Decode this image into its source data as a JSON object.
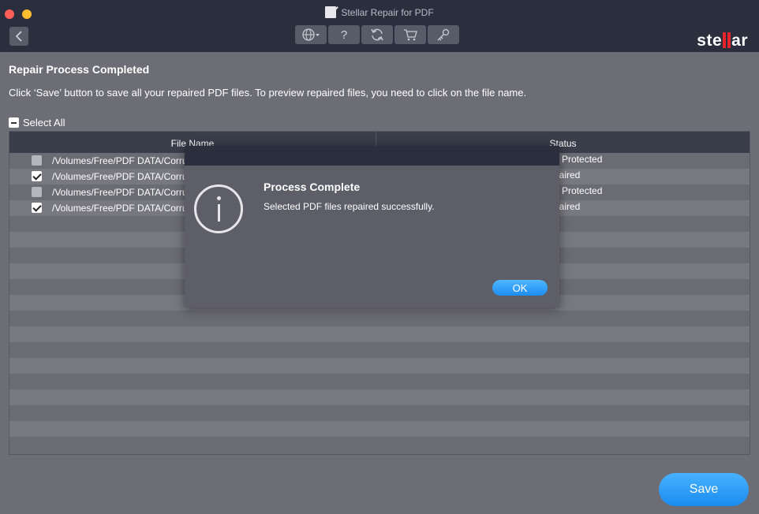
{
  "window": {
    "title": "Stellar Repair for PDF"
  },
  "toolbar": {
    "tools": [
      {
        "name": "language",
        "icon": "globe-icon"
      },
      {
        "name": "help",
        "icon": "question-icon",
        "glyph": "?"
      },
      {
        "name": "update",
        "icon": "refresh-icon"
      },
      {
        "name": "buy",
        "icon": "cart-icon"
      },
      {
        "name": "activate",
        "icon": "key-icon"
      }
    ]
  },
  "brand": {
    "logo_prefix": "ste",
    "logo_suffix": "ar",
    "accent": "#e8242a"
  },
  "main": {
    "heading": "Repair Process Completed",
    "instruction": "Click ‘Save’ button to save all your repaired PDF files. To preview repaired files, you need to click on the file name.",
    "select_all_label": "Select All"
  },
  "table": {
    "columns": [
      "File Name",
      "Status"
    ],
    "rows": [
      {
        "checked": false,
        "path": "/Volumes/Free/PDF DATA/Corru",
        "status": "d Protected"
      },
      {
        "checked": true,
        "path": "/Volumes/Free/PDF DATA/Corru",
        "status": "paired"
      },
      {
        "checked": false,
        "path": "/Volumes/Free/PDF DATA/Corru",
        "status": "d Protected"
      },
      {
        "checked": true,
        "path": "/Volumes/Free/PDF DATA/Corru",
        "status": "paired"
      }
    ]
  },
  "actions": {
    "save_label": "Save"
  },
  "dialog": {
    "title": "Process Complete",
    "message": "Selected PDF files repaired successfully.",
    "ok_label": "OK"
  },
  "colors": {
    "titlebar": "#2b2e3d",
    "background": "#6d6d75",
    "button_blue": "#1a8cf0"
  }
}
